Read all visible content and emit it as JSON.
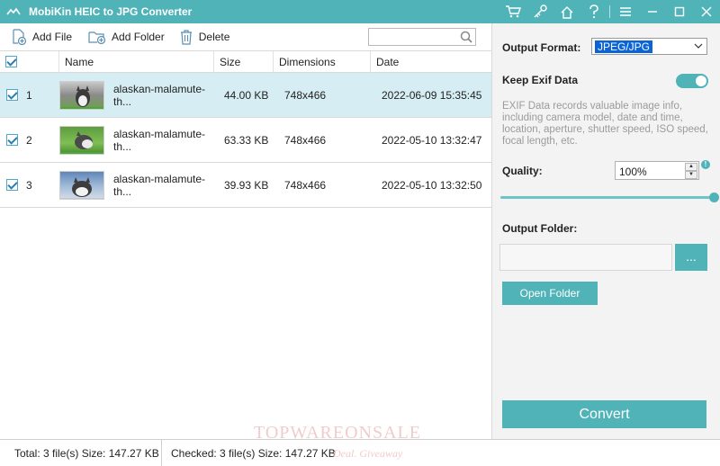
{
  "window": {
    "title": "MobiKin HEIC to JPG Converter"
  },
  "titlebar_icons": [
    "cart-icon",
    "key-icon",
    "home-icon",
    "help-icon",
    "menu-icon",
    "minimize-icon",
    "maximize-icon",
    "close-icon"
  ],
  "toolbar": {
    "add_file": "Add File",
    "add_folder": "Add Folder",
    "delete": "Delete",
    "search_value": ""
  },
  "table": {
    "headers": [
      "Name",
      "Size",
      "Dimensions",
      "Date"
    ],
    "rows": [
      {
        "index": "1",
        "name": "alaskan-malamute-th...",
        "size": "44.00 KB",
        "dimensions": "748x466",
        "date": "2022-06-09 15:35:45",
        "checked": true,
        "selected": true
      },
      {
        "index": "2",
        "name": "alaskan-malamute-th...",
        "size": "63.33 KB",
        "dimensions": "748x466",
        "date": "2022-05-10 13:32:47",
        "checked": true,
        "selected": false
      },
      {
        "index": "3",
        "name": "alaskan-malamute-th...",
        "size": "39.93 KB",
        "dimensions": "748x466",
        "date": "2022-05-10 13:32:50",
        "checked": true,
        "selected": false
      }
    ]
  },
  "settings": {
    "output_format_label": "Output Format:",
    "output_format_value": "JPEG/JPG",
    "keep_exif_label": "Keep Exif Data",
    "keep_exif_on": true,
    "exif_description": "EXIF Data records valuable image info, including camera model, date and time, location, aperture, shutter speed, ISO speed, focal length, etc.",
    "quality_label": "Quality:",
    "quality_value": "100%",
    "quality_level": 1.0,
    "info_glyph": "!",
    "output_folder_label": "Output Folder:",
    "output_folder_value": "",
    "browse_label": "...",
    "open_folder_label": "Open Folder",
    "convert_label": "Convert"
  },
  "status": {
    "total": "Total: 3 file(s) Size: 147.27 KB",
    "checked": "Checked: 3 file(s) Size: 147.27 KB"
  },
  "watermark": {
    "line1": "TOPWAREONSALE",
    "line2": "Deal. Giveaway"
  },
  "colors": {
    "accent": "#4fb3b8",
    "selected_row": "#d6eef3"
  }
}
